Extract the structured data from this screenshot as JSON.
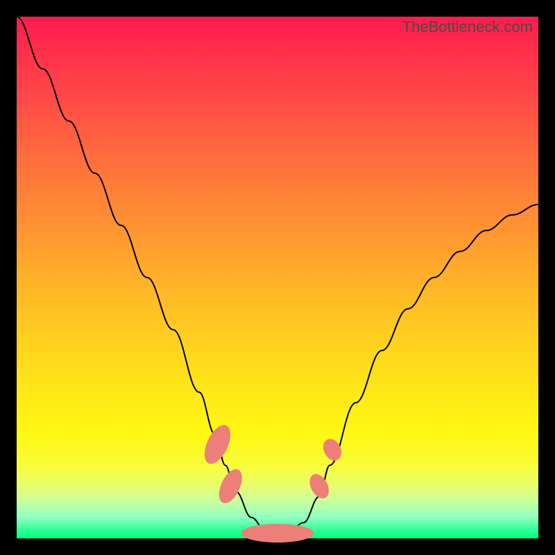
{
  "watermark_text": "TheBottleneck.com",
  "colors": {
    "frame": "#000000",
    "blob": "#ed7f79",
    "curve": "#000000"
  },
  "chart_data": {
    "type": "line",
    "title": "",
    "xlabel": "",
    "ylabel": "",
    "xlim": [
      0,
      100
    ],
    "ylim": [
      0,
      100
    ],
    "series": [
      {
        "name": "bottleneck-curve",
        "x": [
          0,
          5,
          10,
          15,
          20,
          25,
          30,
          35,
          38,
          40,
          42,
          45,
          48,
          50,
          52,
          55,
          58,
          60,
          65,
          70,
          75,
          80,
          85,
          90,
          95,
          100
        ],
        "y": [
          100,
          90,
          80,
          70,
          60,
          50,
          40,
          28,
          20,
          14,
          9,
          4,
          1,
          0,
          1,
          3,
          8,
          14,
          26,
          36,
          44,
          50,
          55,
          59,
          62,
          64
        ]
      }
    ],
    "markers": [
      {
        "name": "left-blob-upper",
        "x": 38.5,
        "y": 18,
        "rx": 2.0,
        "ry": 4.0,
        "rot": 25
      },
      {
        "name": "left-blob-lower",
        "x": 41.0,
        "y": 10,
        "rx": 1.8,
        "ry": 3.5,
        "rot": 25
      },
      {
        "name": "bottom-blob",
        "x": 50.0,
        "y": 1,
        "rx": 7.0,
        "ry": 1.8,
        "rot": 0
      },
      {
        "name": "right-blob-lower",
        "x": 58.0,
        "y": 10,
        "rx": 1.6,
        "ry": 2.5,
        "rot": -28
      },
      {
        "name": "right-blob-upper",
        "x": 60.5,
        "y": 17,
        "rx": 1.6,
        "ry": 2.2,
        "rot": -28
      }
    ],
    "gradient_description": "vertical spectrum red→yellow→green representing bottleneck severity"
  }
}
